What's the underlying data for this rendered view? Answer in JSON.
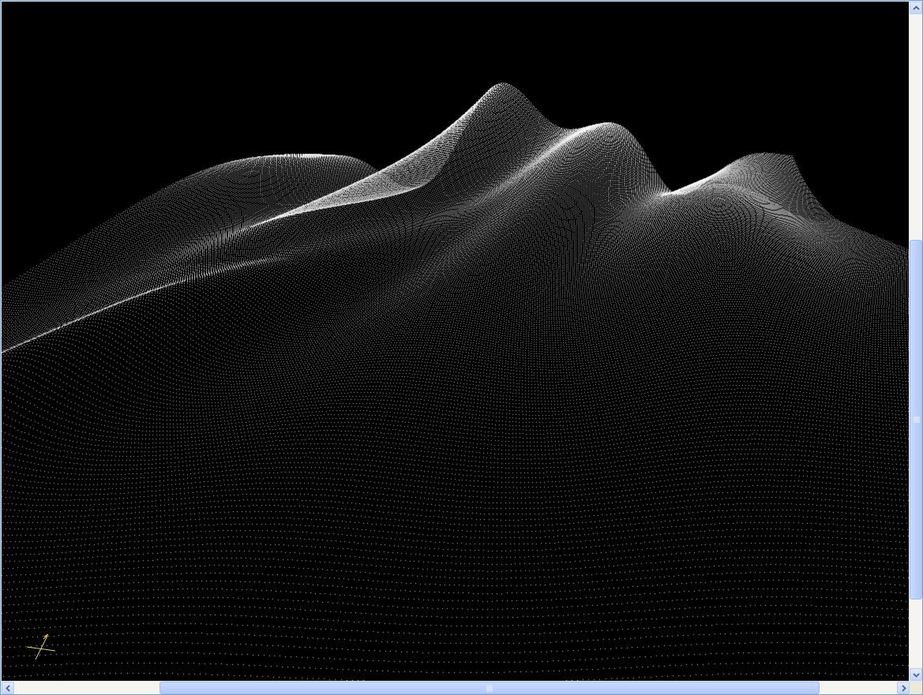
{
  "viewer": {
    "background_color": "#000000",
    "point_color": "#ffffff",
    "axis_color": "#e8d36a",
    "gizmo_icon": "axis-triad-icon"
  },
  "scrollbars": {
    "vertical": {
      "up_icon": "arrow-up-icon",
      "down_icon": "arrow-down-icon",
      "thumb_start_fraction": 0.345,
      "thumb_end_fraction": 0.895
    },
    "horizontal": {
      "left_icon": "arrow-left-icon",
      "right_icon": "arrow-right-icon",
      "thumb_start_fraction": 0.165,
      "thumb_end_fraction": 0.912
    },
    "accent": "#4d6185"
  }
}
